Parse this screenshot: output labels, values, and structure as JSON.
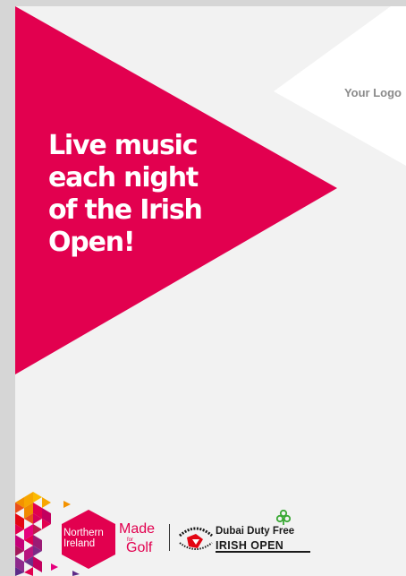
{
  "headline": "Live music\neach night\nof the Irish\nOpen!",
  "logo_placeholder": "Your Logo",
  "footer": {
    "ni_logo": {
      "line1": "Northern",
      "line2": "Ireland"
    },
    "made_for_golf": {
      "made": "Made",
      "for": "for",
      "golf": "Golf"
    },
    "ddf": {
      "name": "Dubai Duty Free",
      "event": "IRISH OPEN"
    }
  },
  "colors": {
    "accent_pink": "#E2004F",
    "background": "#F2F2F2",
    "logo_shape": "#FFFFFF",
    "text_grey": "#8A8A8A"
  }
}
